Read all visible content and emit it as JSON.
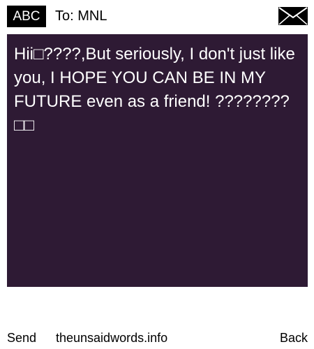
{
  "header": {
    "mode_label": "ABC",
    "to_label": "To: MNL",
    "envelope_icon": "envelope-icon"
  },
  "message": {
    "text": "Hii□????,But seriously, I don't just like you, I HOPE YOU CAN BE IN MY FUTURE even as a friend! ????????□□",
    "background": "#2e1a34",
    "text_color": "#ffffff"
  },
  "footer": {
    "send_label": "Send",
    "site_label": "theunsaidwords.info",
    "back_label": "Back"
  }
}
